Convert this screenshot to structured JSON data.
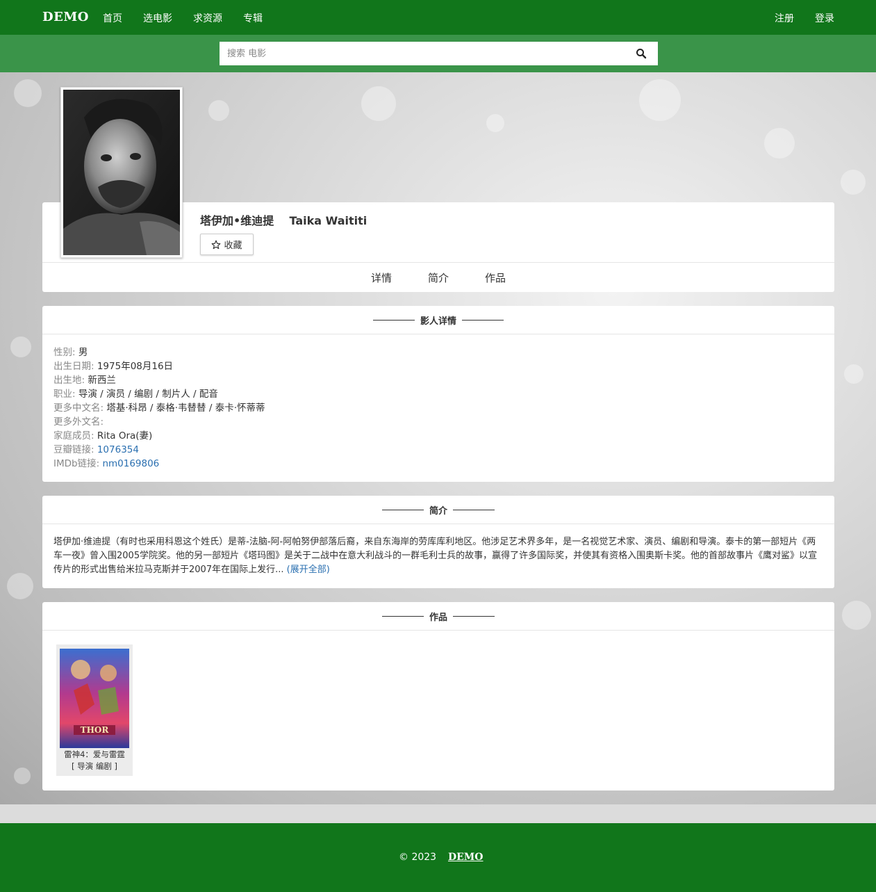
{
  "navbar": {
    "brand": "DEMO",
    "links": [
      "首页",
      "选电影",
      "求资源",
      "专辑"
    ],
    "register": "注册",
    "login": "登录"
  },
  "search": {
    "placeholder": "搜索 电影",
    "icon": "search-icon"
  },
  "person": {
    "name_cn": "塔伊加•维迪提",
    "name_en": "Taika Waititi",
    "favorite_label": "收藏",
    "favorite_icon": "star-icon"
  },
  "tabs": [
    "详情",
    "简介",
    "作品"
  ],
  "details": {
    "title": "影人详情",
    "rows": [
      {
        "key": "性别: ",
        "value": "男"
      },
      {
        "key": "出生日期: ",
        "value": "1975年08月16日"
      },
      {
        "key": "出生地: ",
        "value": "新西兰"
      },
      {
        "key": "职业: ",
        "value": "导演 / 演员 / 编剧 / 制片人 / 配音"
      },
      {
        "key": "更多中文名: ",
        "value": "塔基·科昂 / 泰格·韦替替 / 泰卡·怀蒂蒂"
      },
      {
        "key": "更多外文名: ",
        "value": ""
      },
      {
        "key": "家庭成员: ",
        "value": "Rita Ora(妻)"
      },
      {
        "key": "豆瓣链接: ",
        "value": "1076354",
        "link": true
      },
      {
        "key": "IMDb链接: ",
        "value": "nm0169806",
        "link": true
      }
    ]
  },
  "intro": {
    "title": "简介",
    "text": "塔伊加·维迪提（有时也采用科恩这个姓氏）是蒂-法脑-阿-阿帕努伊部落后裔，来自东海岸的劳库库利地区。他涉足艺术界多年，是一名视觉艺术家、演员、编剧和导演。泰卡的第一部短片《两车一夜》曾入围2005学院奖。他的另一部短片《塔玛图》是关于二战中在意大利战斗的一群毛利士兵的故事，赢得了许多国际奖，并使其有资格入围奥斯卡奖。他的首部故事片《鹰对鲨》以宣传片的形式出售给米拉马克斯并于2007年在国际上发行...",
    "expand": "(展开全部)"
  },
  "works": {
    "title": "作品",
    "items": [
      {
        "title": "雷神4：爱与雷霆",
        "role": "[ 导演 编剧 ]"
      }
    ]
  },
  "footer": {
    "copyright": "© 2023",
    "brand": "DEMO"
  },
  "colors": {
    "nav_green": "#11761b",
    "search_green": "#3a9449",
    "link_blue": "#2a6fb0"
  }
}
